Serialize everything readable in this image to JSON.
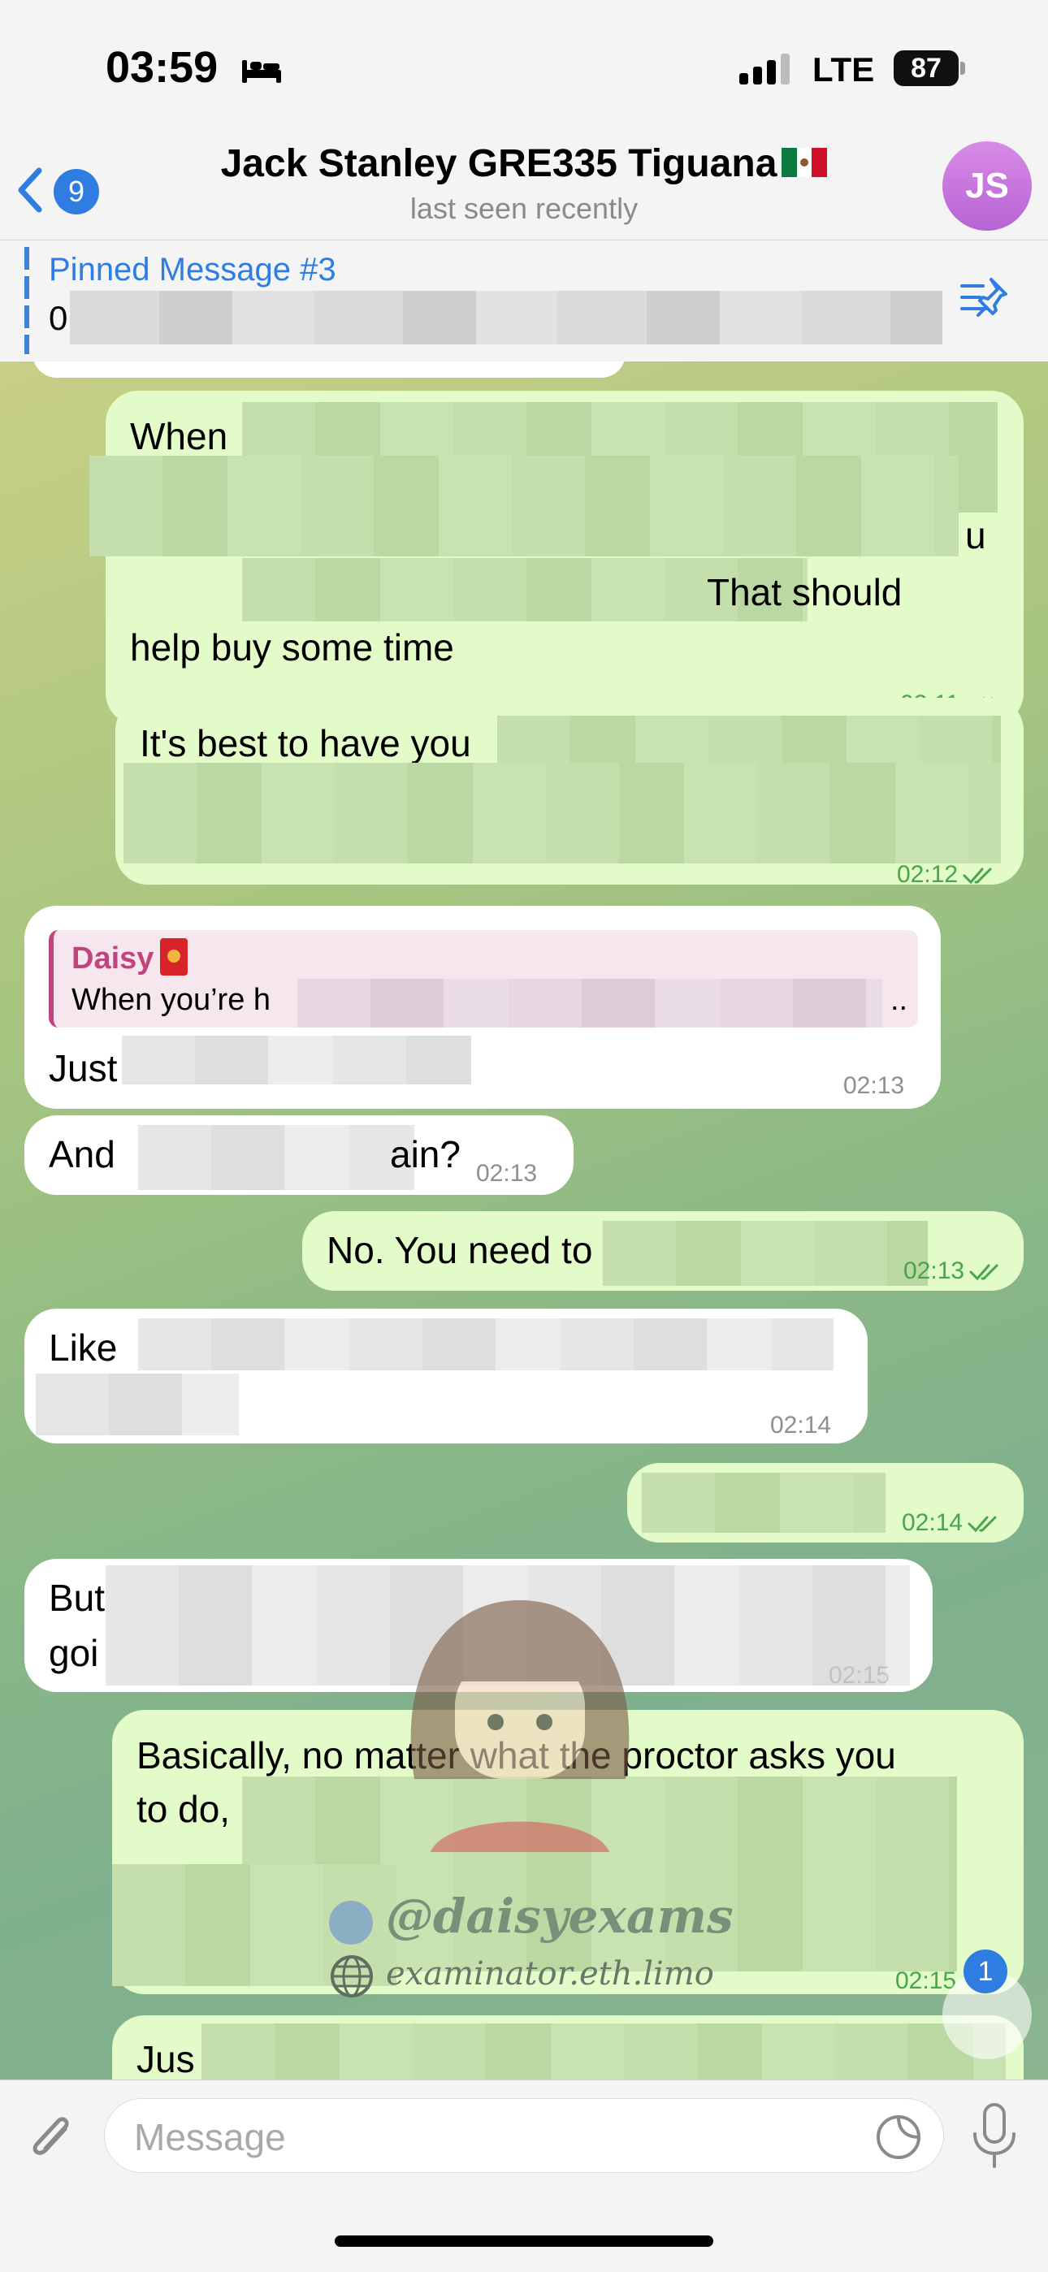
{
  "status_bar": {
    "time": "03:59",
    "carrier": "LTE",
    "battery": "87"
  },
  "nav": {
    "back_count": "9",
    "title": "Jack Stanley GRE335 Tiguana",
    "subtitle": "last seen recently",
    "avatar_initials": "JS"
  },
  "pinned": {
    "title": "Pinned Message #3",
    "text": "0"
  },
  "messages": [
    {
      "side": "out",
      "lines": [
        "When",
        "u",
        "That should",
        "help buy some time"
      ],
      "time": "02:11"
    },
    {
      "side": "out",
      "lines": [
        "It's best to have you"
      ],
      "time": "02:12"
    },
    {
      "side": "in",
      "reply_name": "Daisy",
      "reply_text": "When you’re h",
      "reply_tail": "..",
      "lines": [
        "Just"
      ],
      "time": "02:13"
    },
    {
      "side": "in",
      "lines": [
        "And",
        "ain?"
      ],
      "time": "02:13"
    },
    {
      "side": "out",
      "lines": [
        "No. You need to"
      ],
      "time": "02:13"
    },
    {
      "side": "in",
      "lines": [
        "Like"
      ],
      "time": "02:14"
    },
    {
      "side": "out",
      "lines": [
        ""
      ],
      "time": "02:14"
    },
    {
      "side": "in",
      "lines": [
        "But",
        "goi"
      ],
      "time": "02:15"
    },
    {
      "side": "out",
      "lines": [
        "Basically, no matter what the proctor asks you",
        "to do,"
      ],
      "time": "02:15"
    },
    {
      "side": "out",
      "lines": [
        "Jus"
      ],
      "time": ""
    }
  ],
  "watermark": {
    "handle": "@daisyexams",
    "site": "examinator.eth.limo"
  },
  "scroll_badge": "1",
  "composer": {
    "placeholder": "Message"
  }
}
